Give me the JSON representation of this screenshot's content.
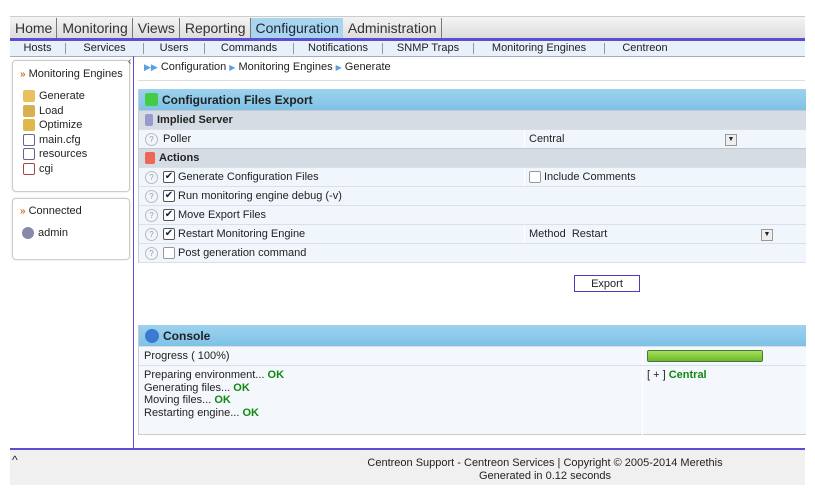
{
  "topnav": [
    "Home",
    "Monitoring",
    "Views",
    "Reporting",
    "Configuration",
    "Administration"
  ],
  "subnav": [
    "Hosts",
    "Services",
    "Users",
    "Commands",
    "Notifications",
    "SNMP Traps",
    "Monitoring Engines",
    "Centreon"
  ],
  "sidebar": {
    "title": "Monitoring Engines",
    "items": [
      "Generate",
      "Load",
      "Optimize",
      "main.cfg",
      "resources",
      "cgi"
    ],
    "connected_title": "Connected",
    "user": "admin"
  },
  "breadcrumb": [
    "Configuration",
    "Monitoring Engines",
    "Generate"
  ],
  "form": {
    "title": "Configuration Files Export",
    "implied_server": "Implied Server",
    "poller_label": "Poller",
    "poller_value": "Central",
    "actions": "Actions",
    "gen": "Generate Configuration Files",
    "include_comments": "Include Comments",
    "debug": "Run monitoring engine debug (-v)",
    "move": "Move Export Files",
    "restart": "Restart Monitoring Engine",
    "method_label": "Method",
    "method_value": "Restart",
    "post": "Post generation command",
    "checks": {
      "gen": true,
      "include_comments": false,
      "debug": true,
      "move": true,
      "restart": true,
      "post": false
    }
  },
  "export_label": "Export",
  "console": {
    "title": "Console",
    "progress_label": "Progress ( 100%)",
    "progress": 100,
    "lines": [
      {
        "text": "Preparing environment...",
        "status": "OK"
      },
      {
        "text": "Generating files...",
        "status": "OK"
      },
      {
        "text": "Moving files...",
        "status": "OK"
      },
      {
        "text": "Restarting engine...",
        "status": "OK"
      }
    ],
    "poller_toggle": "[ + ]",
    "poller_name": "Central"
  },
  "footer": {
    "line1": "Centreon Support - Centreon Services | Copyright © 2005-2014 Merethis",
    "line2": "Generated in 0.12 seconds",
    "top": "^"
  }
}
